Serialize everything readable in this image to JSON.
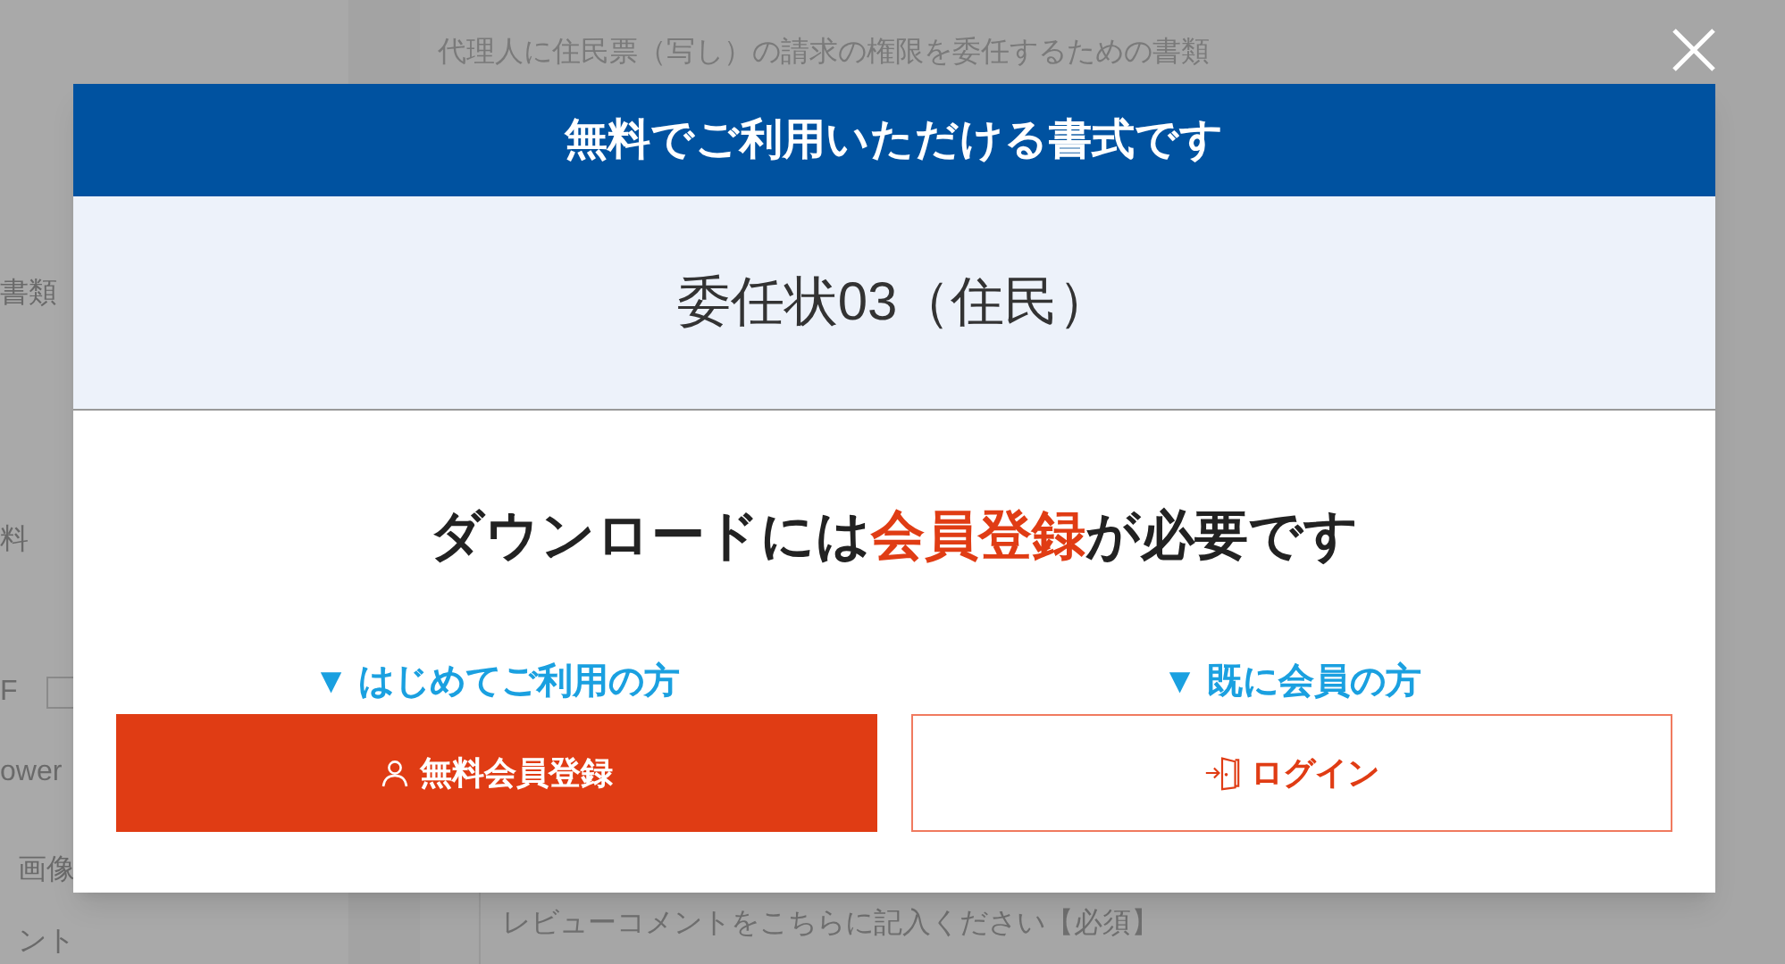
{
  "background": {
    "sidebar_items": [
      {
        "label": "書類",
        "kind": "text"
      },
      {
        "label": "料",
        "kind": "text"
      },
      {
        "label": "F",
        "kind": "checkbox",
        "checked": false
      },
      {
        "label": "ower",
        "kind": "text"
      },
      {
        "label": "画像",
        "kind": "text"
      },
      {
        "label": "ント",
        "kind": "text"
      }
    ],
    "description": "代理人に住民票（写し）の請求の権限を委任するための書類",
    "review": {
      "placeholder": "レビューコメントをこちらに記入ください【必須】"
    }
  },
  "modal": {
    "title": "無料でご利用いただける書式です",
    "form_name": "委任状03（住民）",
    "message": {
      "before": "ダウンロードには",
      "highlight": "会員登録",
      "after": "が必要です"
    },
    "options": [
      {
        "caption": "▼ はじめてご利用の方",
        "button": "無料会員登録",
        "kind": "register"
      },
      {
        "caption": "▼ 既に会員の方",
        "button": "ログイン",
        "kind": "login"
      }
    ]
  }
}
